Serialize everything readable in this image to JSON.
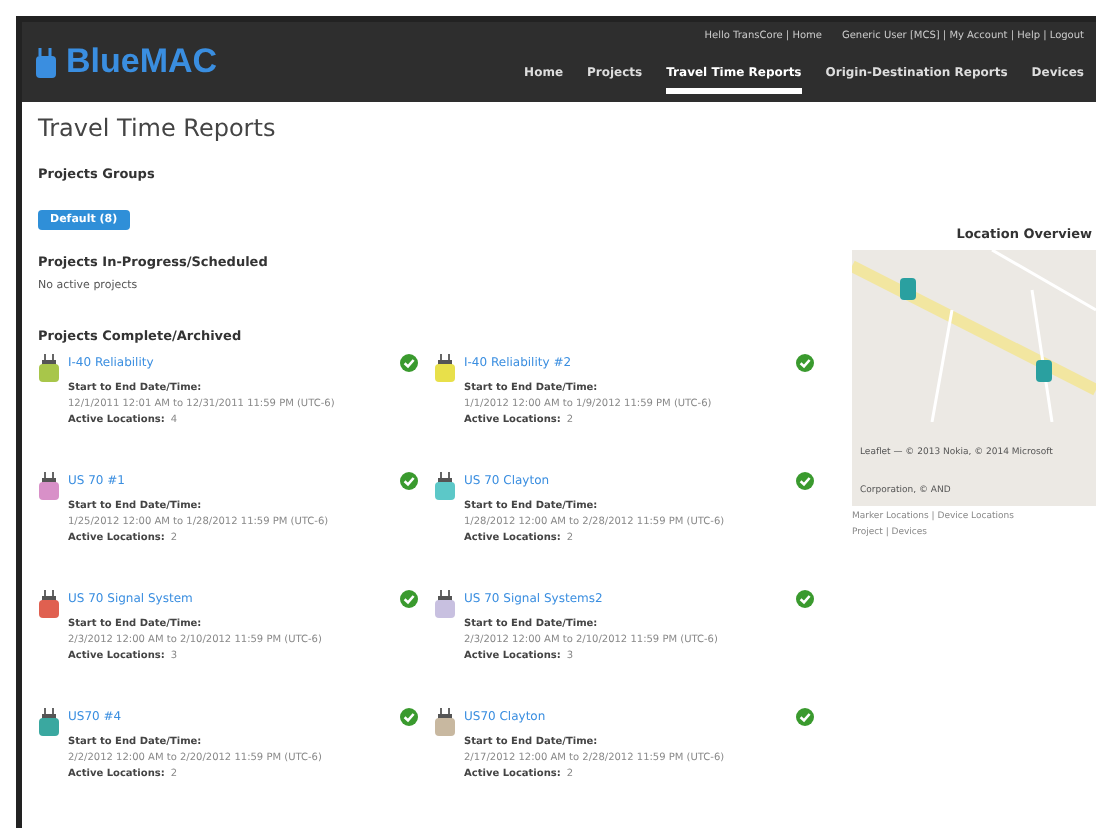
{
  "header": {
    "logo": "BlueMAC",
    "user_links": "Hello TransCore | Home",
    "account_links": "Generic User [MCS] | My Account | Help | Logout",
    "nav": [
      {
        "label": "Home",
        "selected": false
      },
      {
        "label": "Projects",
        "selected": false
      },
      {
        "label": "Travel Time Reports",
        "selected": true
      },
      {
        "label": "Origin-Destination Reports",
        "selected": false
      },
      {
        "label": "Devices",
        "selected": false
      }
    ]
  },
  "page_title": "Travel Time Reports",
  "groups": {
    "heading": "Projects Groups",
    "buttons": [
      "Default (8)"
    ]
  },
  "in_progress": {
    "heading": "Projects In-Progress/Scheduled",
    "empty_text": "No active projects"
  },
  "complete": {
    "heading": "Projects Complete/Archived",
    "projects": [
      {
        "name": "I-40 Reliability",
        "color": "#a8c64a",
        "date_label": "Start to End Date/Time:",
        "dates": "12/1/2011 12:01 AM to 12/31/2011 11:59 PM (UTC-6)",
        "locations_label": "Active Locations:",
        "locations": "4",
        "complete": true
      },
      {
        "name": "I-40 Reliability #2",
        "color": "#e8e04a",
        "date_label": "Start to End Date/Time:",
        "dates": "1/1/2012 12:00 AM to 1/9/2012 11:59 PM (UTC-6)",
        "locations_label": "Active Locations:",
        "locations": "2",
        "complete": true
      },
      {
        "name": "US 70 #1",
        "color": "#d890c8",
        "date_label": "Start to End Date/Time:",
        "dates": "1/25/2012 12:00 AM to 1/28/2012 11:59 PM (UTC-6)",
        "locations_label": "Active Locations:",
        "locations": "2",
        "complete": true
      },
      {
        "name": "US 70 Clayton",
        "color": "#5cc8c8",
        "date_label": "Start to End Date/Time:",
        "dates": "1/28/2012 12:00 AM to 2/28/2012 11:59 PM (UTC-6)",
        "locations_label": "Active Locations:",
        "locations": "2",
        "complete": true
      },
      {
        "name": "US 70 Signal System",
        "color": "#e06050",
        "date_label": "Start to End Date/Time:",
        "dates": "2/3/2012 12:00 AM to 2/10/2012 11:59 PM (UTC-6)",
        "locations_label": "Active Locations:",
        "locations": "3",
        "complete": true
      },
      {
        "name": "US 70 Signal Systems2",
        "color": "#c8c0e0",
        "date_label": "Start to End Date/Time:",
        "dates": "2/3/2012 12:00 AM to 2/10/2012 11:59 PM (UTC-6)",
        "locations_label": "Active Locations:",
        "locations": "3",
        "complete": true
      },
      {
        "name": "US70 #4",
        "color": "#3aa8a0",
        "date_label": "Start to End Date/Time:",
        "dates": "2/2/2012 12:00 AM to 2/20/2012 11:59 PM (UTC-6)",
        "locations_label": "Active Locations:",
        "locations": "2",
        "complete": true
      },
      {
        "name": "US70 Clayton",
        "color": "#c8b8a0",
        "date_label": "Start to End Date/Time:",
        "dates": "2/17/2012 12:00 AM to 2/28/2012 11:59 PM (UTC-6)",
        "locations_label": "Active Locations:",
        "locations": "2",
        "complete": true
      }
    ]
  },
  "location_overview": {
    "heading": "Location Overview",
    "map_labels": [
      "Leaflet — © 2013 Nokia, © 2014 Microsoft Corporation, © AND"
    ],
    "legend": "Marker Locations | Device Locations",
    "footnote": "Project | Devices"
  }
}
